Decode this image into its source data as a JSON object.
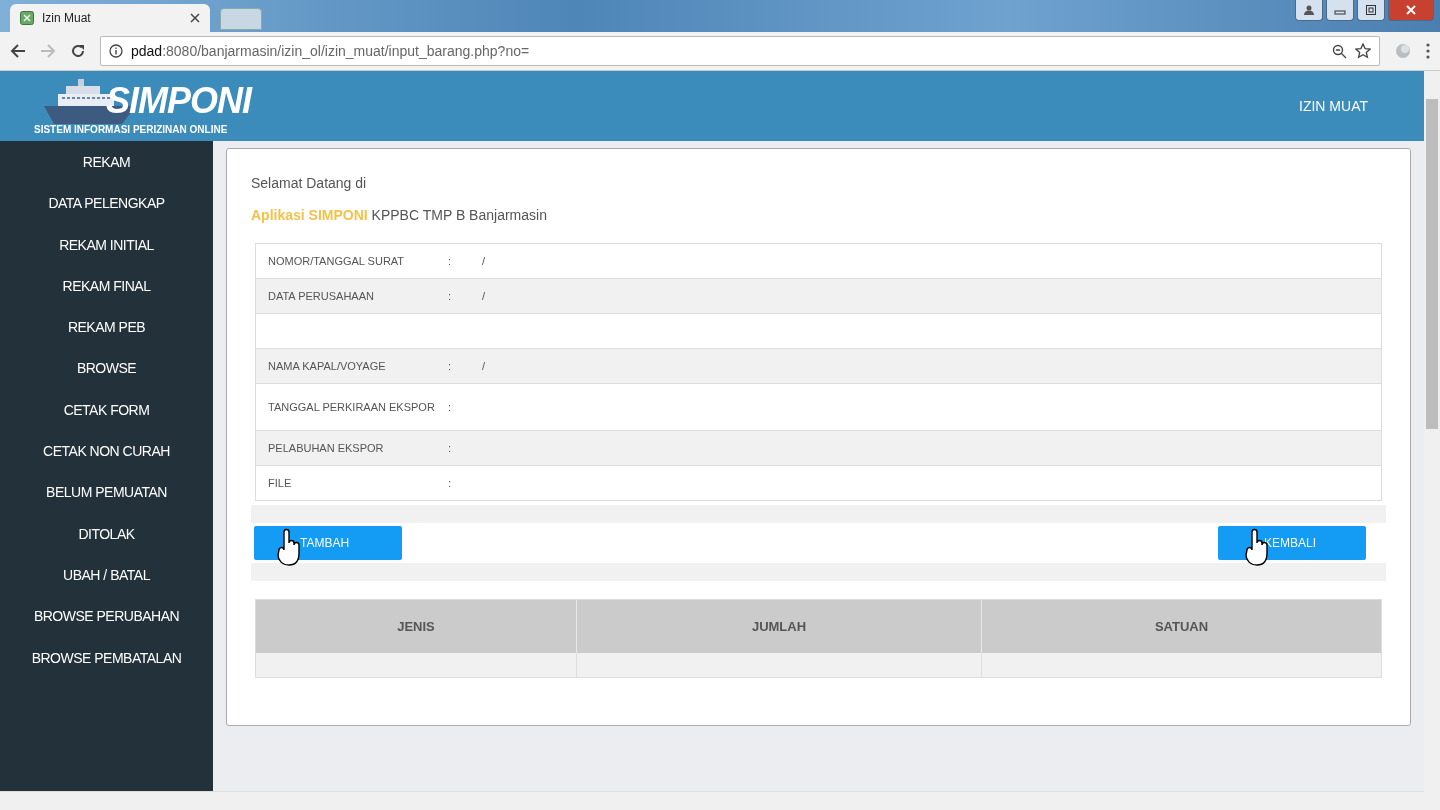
{
  "browser": {
    "tab_title": "Izin Muat",
    "url_host": "pdad",
    "url_path": ":8080/banjarmasin/izin_ol/izin_muat/input_barang.php?no="
  },
  "header": {
    "logo_title": "SIMPONI",
    "logo_subtitle": "SISTEM INFORMASI PERIZINAN ONLINE",
    "nav_link": "IZIN MUAT"
  },
  "sidebar": {
    "items": [
      "REKAM",
      "DATA PELENGKAP",
      "REKAM INITIAL",
      "REKAM FINAL",
      "REKAM PEB",
      "BROWSE",
      "CETAK FORM",
      "CETAK NON CURAH",
      "BELUM PEMUATAN",
      "DITOLAK",
      "UBAH / BATAL",
      "BROWSE PERUBAHAN",
      "BROWSE PEMBATALAN"
    ]
  },
  "welcome": {
    "greeting": "Selamat Datang di",
    "app_line": "**Aplikasi SIMPONI** KPPBC TMP B Banjarmasin"
  },
  "form_rows": [
    {
      "kind": "field",
      "label": "NOMOR/TANGGAL SURAT",
      "separator": ":",
      "value": "/"
    },
    {
      "kind": "field",
      "label": "DATA PERUSAHAAN",
      "separator": ":",
      "value": "/"
    },
    {
      "kind": "blank"
    },
    {
      "kind": "field",
      "label": "NAMA KAPAL/VOYAGE",
      "separator": ":",
      "value": "/"
    },
    {
      "kind": "field",
      "label": "TANGGAL PERKIRAAN EKSPOR",
      "separator": ":"
    },
    {
      "kind": "field",
      "label": "PELABUHAN EKSPOR",
      "separator": ":"
    },
    {
      "kind": "field",
      "label": "FILE",
      "separator": ":"
    }
  ],
  "buttons": {
    "add": "TAMBAH",
    "back": "KEMBALI"
  },
  "table": {
    "columns": [
      "JENIS",
      "JUMLAH",
      "SATUAN"
    ]
  }
}
